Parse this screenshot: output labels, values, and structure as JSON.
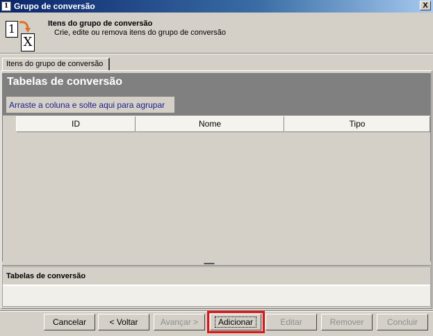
{
  "window": {
    "title": "Grupo de conversão",
    "close_label": "X"
  },
  "header": {
    "title": "Itens do grupo de conversão",
    "subtitle": "Crie, edite ou remova itens do grupo de conversão",
    "icon": "conversion-1-to-x-icon",
    "icon_left": "1",
    "icon_right": "X"
  },
  "tabs": [
    {
      "label": "Itens do grupo de conversão",
      "selected": true
    }
  ],
  "grid": {
    "title": "Tabelas de conversão",
    "group_hint": "Arraste a coluna e solte aqui para agrupar",
    "columns": [
      "ID",
      "Nome",
      "Tipo"
    ],
    "rows": []
  },
  "detail": {
    "title": "Tabelas de conversão"
  },
  "buttons": {
    "cancelar": "Cancelar",
    "voltar": "< Voltar",
    "avancar": "Avançar >",
    "adicionar": "Adicionar",
    "editar": "Editar",
    "remover": "Remover",
    "concluir": "Concluir"
  },
  "colors": {
    "titlebar": "#0a246a",
    "face": "#d4d0c8",
    "grid_band": "#808080",
    "highlight": "#e01414",
    "group_hint_text": "#1c1c8c"
  }
}
